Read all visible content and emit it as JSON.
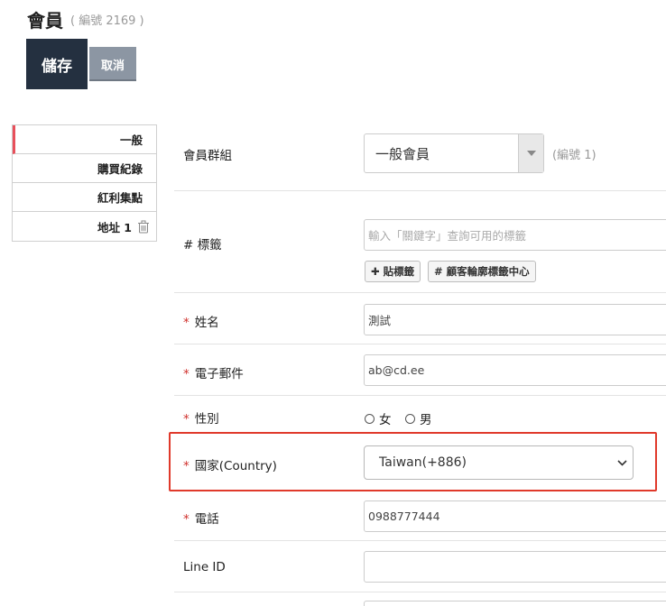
{
  "header": {
    "title": "會員",
    "record_no": "( 編號 2169 )",
    "save_label": "儲存",
    "cancel_label": "取消"
  },
  "tabs": [
    {
      "label": "一般"
    },
    {
      "label": "購買紀錄"
    },
    {
      "label": "紅利集點"
    },
    {
      "label": "地址 1"
    }
  ],
  "form": {
    "member_group": {
      "label": "會員群組",
      "value": "一般會員",
      "group_no": "(編號 1)"
    },
    "tags": {
      "label": "# 標籤",
      "placeholder": "輸入「關鍵字」查詢可用的標籤",
      "add_tag_label": "✚ 貼標籤",
      "tag_center_label": "# 顧客輪廓標籤中心"
    },
    "name": {
      "required": "*",
      "label": "姓名",
      "value": "測試"
    },
    "email": {
      "required": "*",
      "label": "電子郵件",
      "value": "ab@cd.ee"
    },
    "gender": {
      "required": "*",
      "label": "性別",
      "options": [
        {
          "label": "女"
        },
        {
          "label": "男"
        }
      ]
    },
    "country": {
      "required": "*",
      "label": "國家(Country)",
      "value": "Taiwan(+886)"
    },
    "phone": {
      "required": "*",
      "label": "電話",
      "value": "0988777444"
    },
    "line_id": {
      "label": "Line ID",
      "value": ""
    }
  },
  "colors": {
    "save_bg": "#243040",
    "cancel_bg": "#8c96a3",
    "required": "#d0312d",
    "highlight": "#e0392b",
    "active_tab_marker": "#e8505b"
  }
}
